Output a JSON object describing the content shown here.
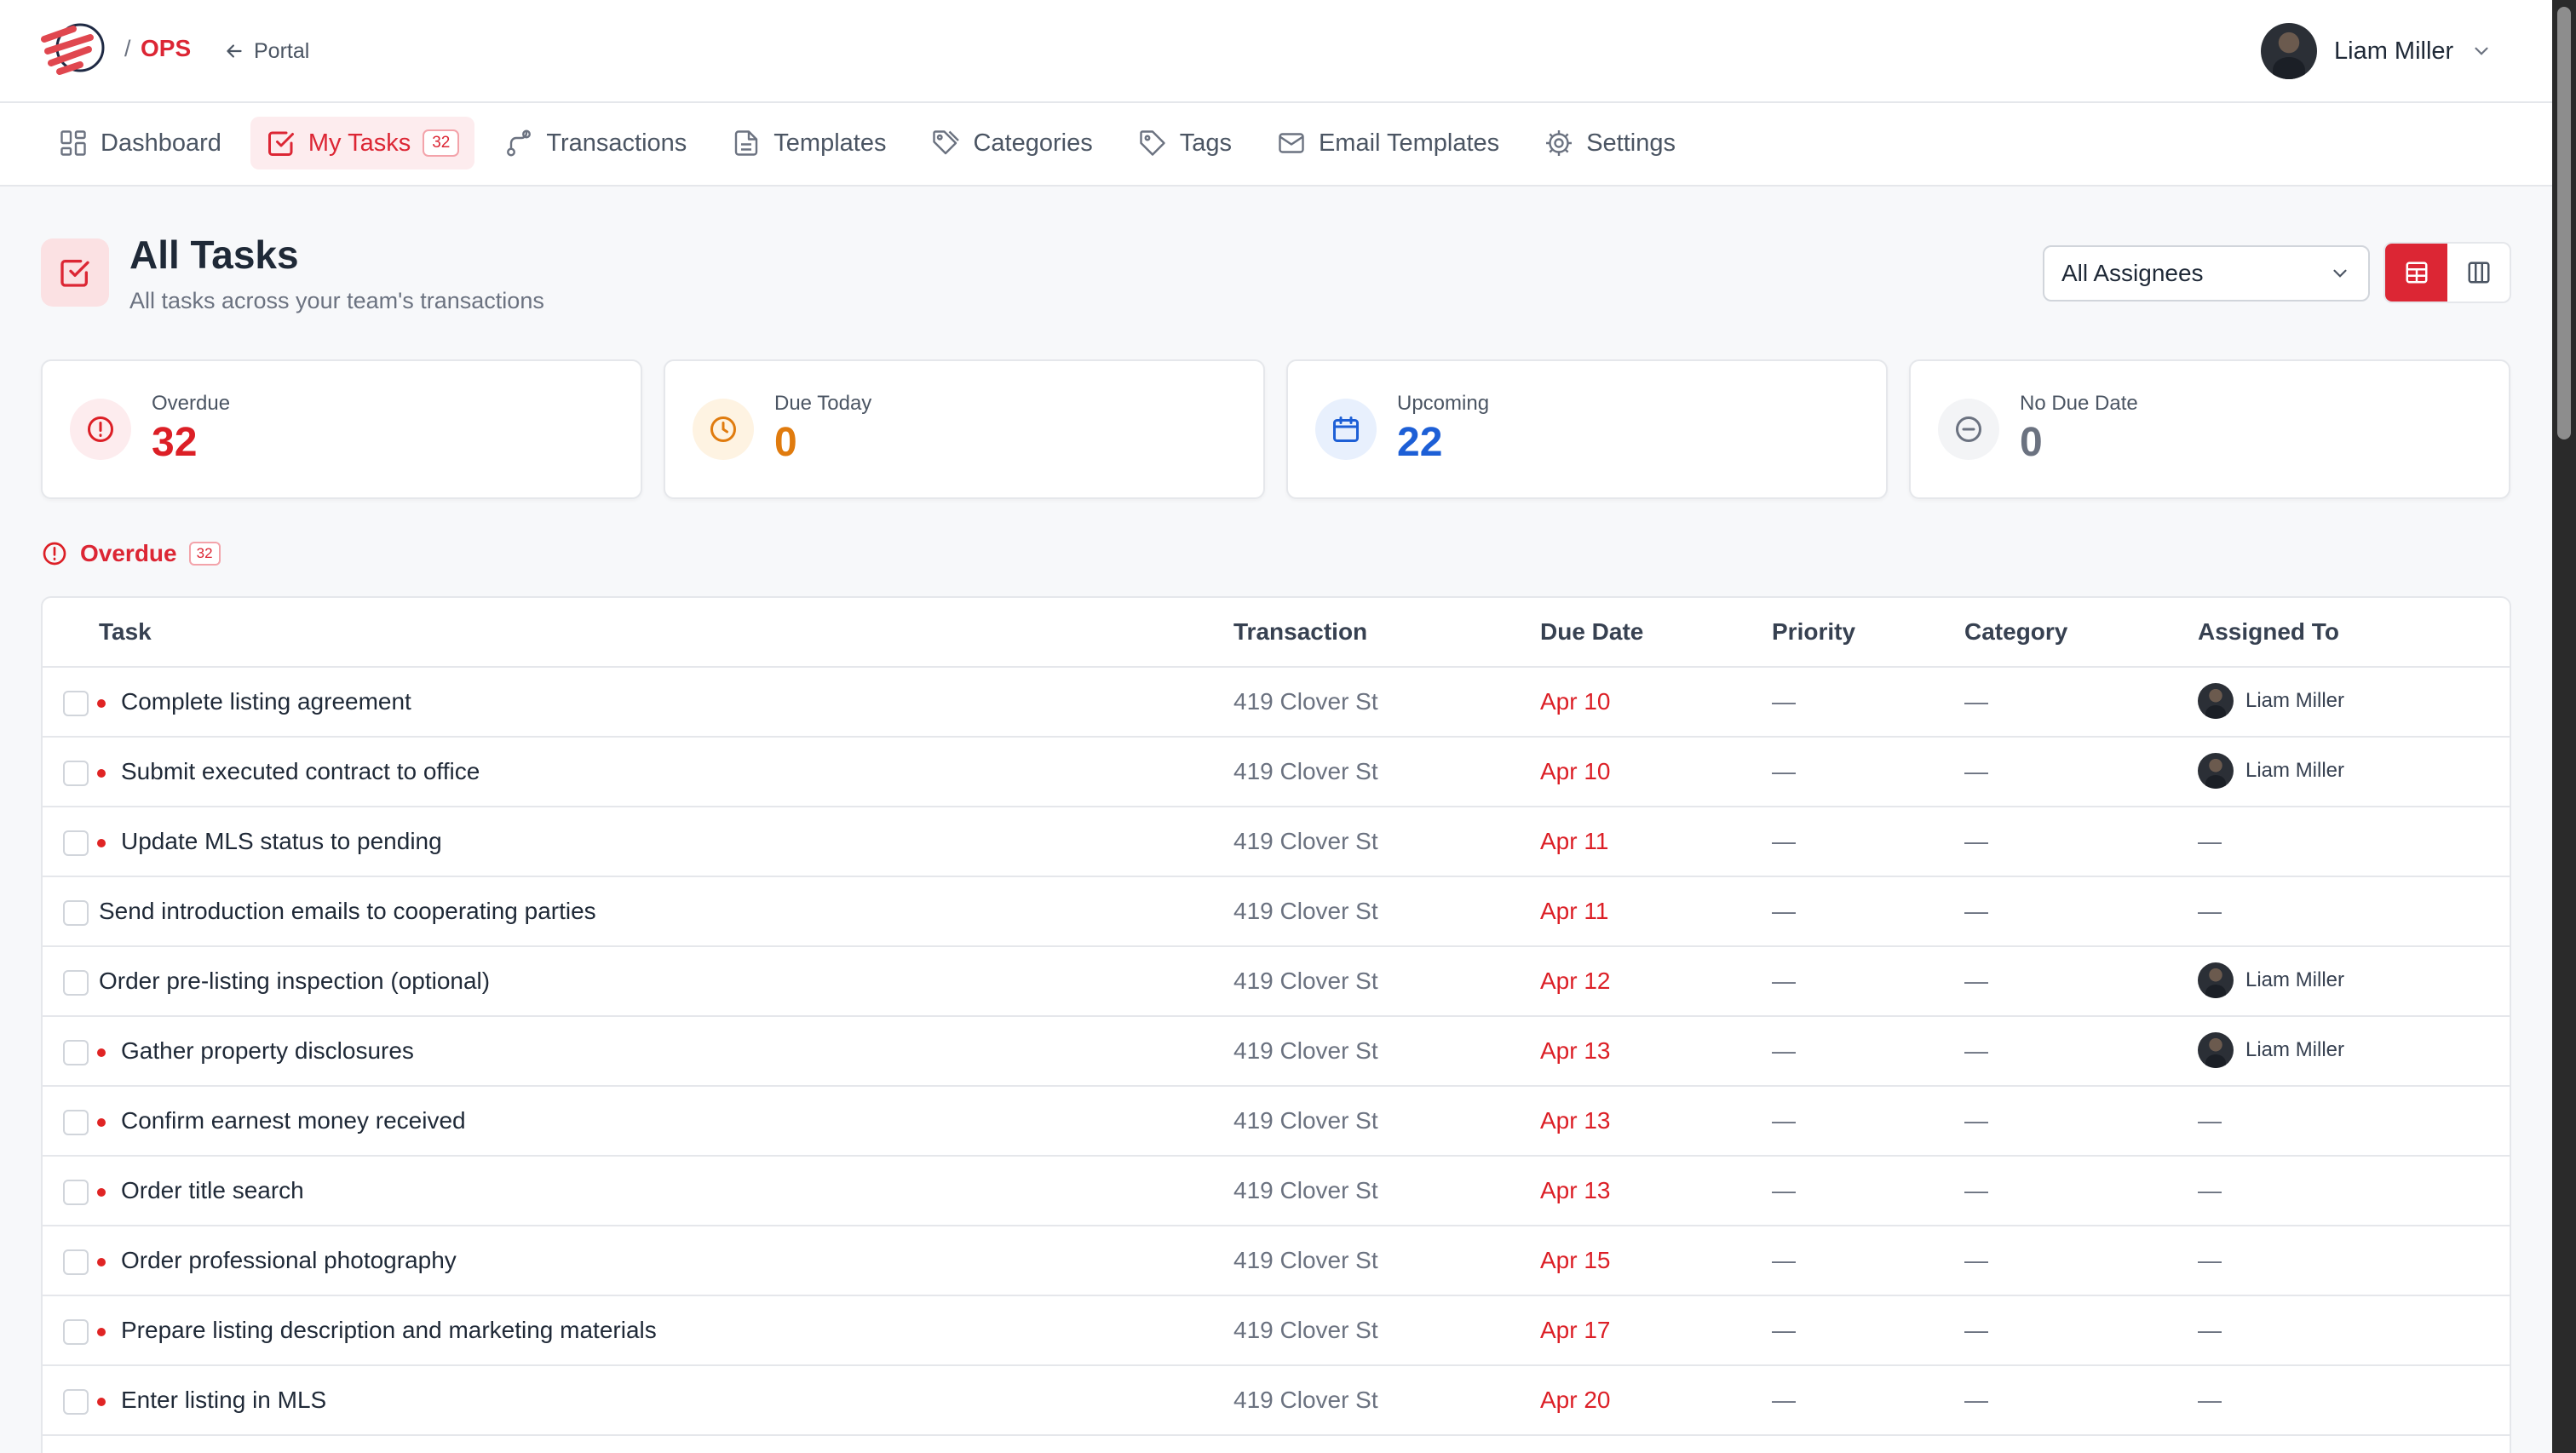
{
  "header": {
    "separator": "/",
    "app_name": "OPS",
    "portal_label": "Portal",
    "user_name": "Liam Miller"
  },
  "nav": {
    "items": [
      {
        "label": "Dashboard",
        "icon": "grid-icon"
      },
      {
        "label": "My Tasks",
        "icon": "checkbox-icon",
        "badge": "32",
        "active": true
      },
      {
        "label": "Transactions",
        "icon": "route-icon"
      },
      {
        "label": "Templates",
        "icon": "document-icon"
      },
      {
        "label": "Categories",
        "icon": "tags-icon"
      },
      {
        "label": "Tags",
        "icon": "tag-icon"
      },
      {
        "label": "Email Templates",
        "icon": "mail-icon"
      },
      {
        "label": "Settings",
        "icon": "gear-icon"
      }
    ]
  },
  "page": {
    "title": "All Tasks",
    "subtitle": "All tasks across your team's transactions",
    "assignee_filter": "All Assignees"
  },
  "stats": [
    {
      "label": "Overdue",
      "value": "32",
      "color": "#dc1f26",
      "icon": "alert-circle-icon"
    },
    {
      "label": "Due Today",
      "value": "0",
      "color": "#e07b0e",
      "icon": "clock-icon"
    },
    {
      "label": "Upcoming",
      "value": "22",
      "color": "#1d5fd6",
      "icon": "calendar-icon"
    },
    {
      "label": "No Due Date",
      "value": "0",
      "color": "#6b7280",
      "icon": "minus-circle-icon"
    }
  ],
  "section": {
    "title": "Overdue",
    "count": "32"
  },
  "table": {
    "columns": [
      "Task",
      "Transaction",
      "Due Date",
      "Priority",
      "Category",
      "Assigned To"
    ],
    "rows": [
      {
        "task": "Complete listing agreement",
        "dot": true,
        "transaction": "419 Clover St",
        "due": "Apr 10",
        "priority": "—",
        "category": "—",
        "assigned": "Liam Miller"
      },
      {
        "task": "Submit executed contract to office",
        "dot": true,
        "transaction": "419 Clover St",
        "due": "Apr 10",
        "priority": "—",
        "category": "—",
        "assigned": "Liam Miller"
      },
      {
        "task": "Update MLS status to pending",
        "dot": true,
        "transaction": "419 Clover St",
        "due": "Apr 11",
        "priority": "—",
        "category": "—",
        "assigned": "—"
      },
      {
        "task": "Send introduction emails to cooperating parties",
        "dot": false,
        "transaction": "419 Clover St",
        "due": "Apr 11",
        "priority": "—",
        "category": "—",
        "assigned": "—"
      },
      {
        "task": "Order pre-listing inspection (optional)",
        "dot": false,
        "transaction": "419 Clover St",
        "due": "Apr 12",
        "priority": "—",
        "category": "—",
        "assigned": "Liam Miller"
      },
      {
        "task": "Gather property disclosures",
        "dot": true,
        "transaction": "419 Clover St",
        "due": "Apr 13",
        "priority": "—",
        "category": "—",
        "assigned": "Liam Miller"
      },
      {
        "task": "Confirm earnest money received",
        "dot": true,
        "transaction": "419 Clover St",
        "due": "Apr 13",
        "priority": "—",
        "category": "—",
        "assigned": "—"
      },
      {
        "task": "Order title search",
        "dot": true,
        "transaction": "419 Clover St",
        "due": "Apr 13",
        "priority": "—",
        "category": "—",
        "assigned": "—"
      },
      {
        "task": "Order professional photography",
        "dot": true,
        "transaction": "419 Clover St",
        "due": "Apr 15",
        "priority": "—",
        "category": "—",
        "assigned": "—"
      },
      {
        "task": "Prepare listing description and marketing materials",
        "dot": true,
        "transaction": "419 Clover St",
        "due": "Apr 17",
        "priority": "—",
        "category": "—",
        "assigned": "—"
      },
      {
        "task": "Enter listing in MLS",
        "dot": true,
        "transaction": "419 Clover St",
        "due": "Apr 20",
        "priority": "—",
        "category": "—",
        "assigned": "—"
      }
    ]
  },
  "colors": {
    "brand": "#dc2634",
    "overdue": "#dc1f26",
    "due_today": "#e07b0e",
    "upcoming": "#1d5fd6"
  }
}
